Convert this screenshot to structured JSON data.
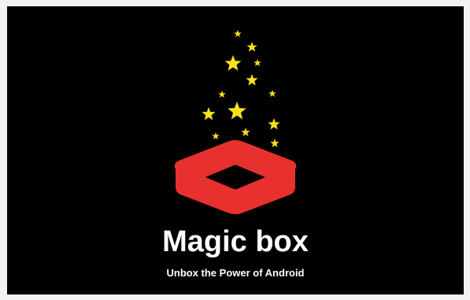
{
  "splash": {
    "app_title": "Magic box",
    "tagline": "Unbox the Power of Android",
    "logo_icon": "magic-box-icon",
    "colors": {
      "background": "#000000",
      "box": "#e8302f",
      "stars": "#f8e21a",
      "text": "#ffffff",
      "frame": "#f2f2f2"
    }
  }
}
